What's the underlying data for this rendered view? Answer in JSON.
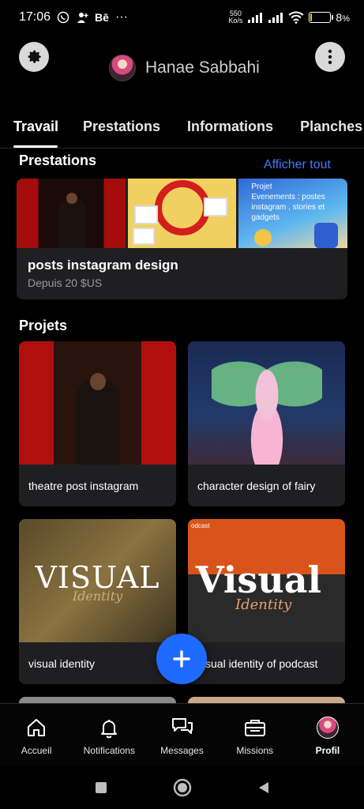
{
  "status_bar": {
    "time": "17:06",
    "carrier_tag": "Bē",
    "more_dots": "···",
    "net_speed_value": "550",
    "net_speed_unit": "Ko/s",
    "battery_percent": "8",
    "battery_symbol": "%",
    "battery_level": 0.08
  },
  "header": {
    "profile_name": "Hanae Sabbahi"
  },
  "tabs": [
    {
      "label": "Travail",
      "active": true
    },
    {
      "label": "Prestations"
    },
    {
      "label": "Informations"
    },
    {
      "label": "Planches"
    }
  ],
  "services_section": {
    "title": "Prestations",
    "see_all": "Afficher tout",
    "card": {
      "thumb3_text": "Projet\nEvenements : postes instagram , stories et gadgets",
      "title": "posts instagram design",
      "price": "Depuis 20 $US"
    }
  },
  "projects_section": {
    "title": "Projets",
    "items": [
      {
        "caption": "theatre post instagram"
      },
      {
        "caption": "character design of fairy"
      },
      {
        "caption": "visual identity",
        "art_word": "VISUAL",
        "art_sub": "Identity"
      },
      {
        "caption": "sual identity of podcast",
        "art_tag": "odcast",
        "art_word": "Visual",
        "art_sub": "Identity"
      }
    ]
  },
  "fab": {
    "icon": "plus-icon"
  },
  "bottom_nav": [
    {
      "label": "Accueil",
      "icon": "home-icon"
    },
    {
      "label": "Notifications",
      "icon": "bell-icon"
    },
    {
      "label": "Messages",
      "icon": "chat-icon"
    },
    {
      "label": "Missions",
      "icon": "briefcase-icon"
    },
    {
      "label": "Profil",
      "icon": "avatar",
      "active": true
    }
  ],
  "colors": {
    "accent": "#1f6bff",
    "link": "#3d7bff",
    "card_bg": "#1f1f22"
  }
}
